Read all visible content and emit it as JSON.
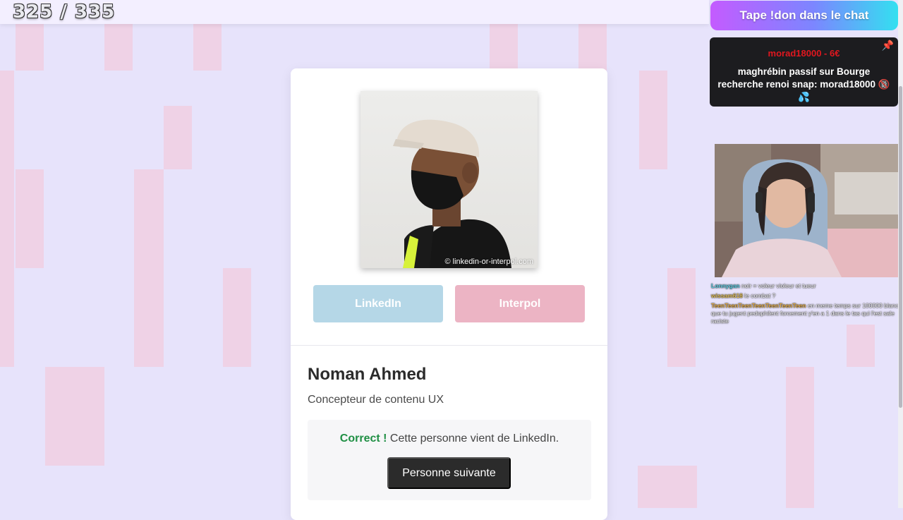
{
  "counter": {
    "current": "325",
    "separator": "/",
    "total": "335"
  },
  "card": {
    "photo_credit": "© linkedin-or-interpol.com",
    "buttons": {
      "linkedin": "LinkedIn",
      "interpol": "Interpol"
    },
    "person": {
      "name": "Noman Ahmed",
      "role": "Concepteur de contenu UX"
    },
    "result": {
      "status": "Correct !",
      "message": "Cette personne vient de LinkedIn.",
      "next_button": "Personne suivante"
    }
  },
  "stream": {
    "don_banner": "Tape !don dans le chat",
    "donation": {
      "donor": "morad18000 - 6€",
      "message": "maghrébin passif sur Bourge recherche renoi snap: morad18000 🔞 💦"
    },
    "chat": [
      {
        "user": "Lonnygan",
        "user_color": "#5fd0e6",
        "text": "noir = voleur violeur et tueur"
      },
      {
        "user": "wissam618",
        "user_color": "#e7c35b",
        "text": "le combat ?"
      },
      {
        "user": "TeenTeenTeenTeenTeenTeenTeen",
        "user_color": "#e8b04a",
        "text": "en meme temps sur 100000 blancs que tu jugent pedophilent forcement y'en a 1 dans le tas qui l'est sale raciste"
      }
    ]
  },
  "colors": {
    "linkedin_button": "#b5d7e7",
    "interpol_button": "#ecb4c4",
    "correct_text": "#1f8f44",
    "next_button": "#2b2b2b",
    "background": "#e7e3fb"
  }
}
